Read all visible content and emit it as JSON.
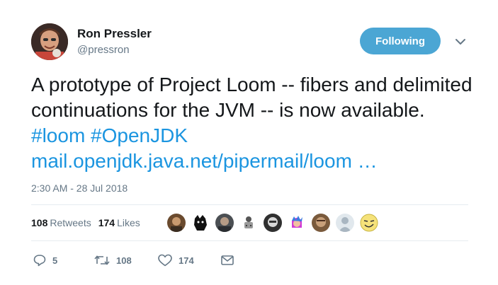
{
  "author": {
    "name": "Ron Pressler",
    "handle": "@pressron"
  },
  "follow_button": {
    "label": "Following"
  },
  "tweet": {
    "text_plain": "A prototype of Project Loom -- fibers and delimited continuations for the JVM -- is now available.",
    "hashtags": [
      "#loom",
      "#OpenJDK"
    ],
    "link": "mail.openjdk.java.net/pipermail/loom …",
    "timestamp": "2:30 AM - 28 Jul 2018"
  },
  "stats": {
    "retweets_count": "108",
    "retweets_label": "Retweets",
    "likes_count": "174",
    "likes_label": "Likes"
  },
  "actions": {
    "replies": "5",
    "retweets": "108",
    "likes": "174"
  },
  "colors": {
    "accent": "#1b95e0",
    "button": "#4ba6d4",
    "muted": "#657786"
  },
  "icons": [
    "chevron-down-icon",
    "reply-icon",
    "retweet-icon",
    "heart-icon",
    "message-icon"
  ]
}
